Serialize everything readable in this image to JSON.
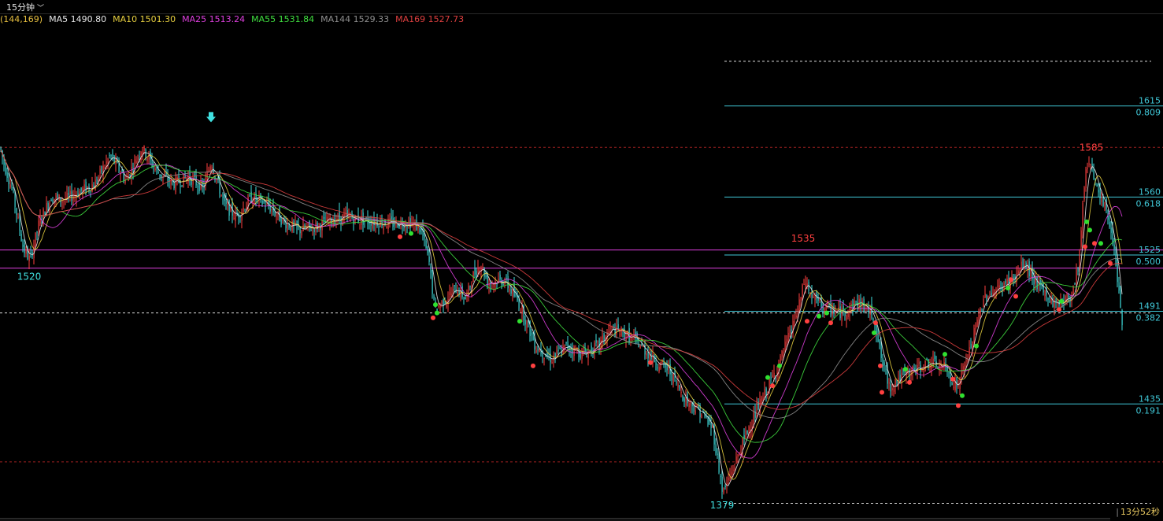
{
  "header": {
    "period_label": "15分钟",
    "chevron": "chevron-down-icon"
  },
  "ma_legend": [
    {
      "label": "(144,169)",
      "color": "#e8c040"
    },
    {
      "label": "MA5 1490.80",
      "color": "#e8e8e8"
    },
    {
      "label": "MA10 1501.30",
      "color": "#e8d040"
    },
    {
      "label": "MA25 1513.24",
      "color": "#e040e0"
    },
    {
      "label": "MA55 1531.84",
      "color": "#40e040"
    },
    {
      "label": "MA144 1529.33",
      "color": "#909090"
    },
    {
      "label": "MA169 1527.73",
      "color": "#e04040"
    }
  ],
  "timer": "13分52秒",
  "colors": {
    "background": "#000000",
    "up": "#ff4040",
    "down": "#40e0e0",
    "fib": "#40c8d8",
    "support": "#e040e0",
    "dashed": "#e0e0e0",
    "red_dashed": "#a02020"
  },
  "chart_data": {
    "type": "candlestick",
    "path": [
      [
        0,
        1590
      ],
      [
        5,
        1580
      ],
      [
        15,
        1565
      ],
      [
        30,
        1528
      ],
      [
        38,
        1522
      ],
      [
        50,
        1545
      ],
      [
        65,
        1560
      ],
      [
        80,
        1558
      ],
      [
        100,
        1563
      ],
      [
        120,
        1568
      ],
      [
        140,
        1585
      ],
      [
        160,
        1570
      ],
      [
        180,
        1590
      ],
      [
        200,
        1575
      ],
      [
        220,
        1568
      ],
      [
        240,
        1572
      ],
      [
        258,
        1565
      ],
      [
        268,
        1582
      ],
      [
        285,
        1555
      ],
      [
        300,
        1548
      ],
      [
        320,
        1560
      ],
      [
        340,
        1555
      ],
      [
        360,
        1545
      ],
      [
        380,
        1540
      ],
      [
        400,
        1542
      ],
      [
        420,
        1546
      ],
      [
        440,
        1548
      ],
      [
        460,
        1546
      ],
      [
        480,
        1545
      ],
      [
        500,
        1544
      ],
      [
        520,
        1545
      ],
      [
        535,
        1540
      ],
      [
        545,
        1520
      ],
      [
        552,
        1492
      ],
      [
        565,
        1498
      ],
      [
        580,
        1505
      ],
      [
        592,
        1498
      ],
      [
        600,
        1512
      ],
      [
        610,
        1520
      ],
      [
        620,
        1508
      ],
      [
        640,
        1510
      ],
      [
        660,
        1495
      ],
      [
        680,
        1470
      ],
      [
        700,
        1462
      ],
      [
        720,
        1470
      ],
      [
        740,
        1465
      ],
      [
        760,
        1470
      ],
      [
        775,
        1480
      ],
      [
        790,
        1478
      ],
      [
        810,
        1472
      ],
      [
        830,
        1462
      ],
      [
        850,
        1455
      ],
      [
        870,
        1438
      ],
      [
        890,
        1430
      ],
      [
        905,
        1420
      ],
      [
        918,
        1381
      ],
      [
        930,
        1395
      ],
      [
        950,
        1420
      ],
      [
        970,
        1440
      ],
      [
        990,
        1460
      ],
      [
        1005,
        1480
      ],
      [
        1015,
        1495
      ],
      [
        1022,
        1510
      ],
      [
        1030,
        1500
      ],
      [
        1050,
        1492
      ],
      [
        1070,
        1490
      ],
      [
        1090,
        1497
      ],
      [
        1110,
        1488
      ],
      [
        1120,
        1460
      ],
      [
        1130,
        1445
      ],
      [
        1140,
        1450
      ],
      [
        1160,
        1455
      ],
      [
        1180,
        1460
      ],
      [
        1200,
        1457
      ],
      [
        1215,
        1445
      ],
      [
        1230,
        1465
      ],
      [
        1250,
        1500
      ],
      [
        1270,
        1505
      ],
      [
        1290,
        1512
      ],
      [
        1300,
        1520
      ],
      [
        1320,
        1505
      ],
      [
        1340,
        1495
      ],
      [
        1360,
        1500
      ],
      [
        1370,
        1520
      ],
      [
        1378,
        1575
      ],
      [
        1385,
        1583
      ],
      [
        1395,
        1560
      ],
      [
        1405,
        1552
      ],
      [
        1415,
        1530
      ],
      [
        1425,
        1485
      ]
    ],
    "ylim": [
      1370,
      1660
    ],
    "x_count": 1425,
    "fib_levels": [
      {
        "price": "1615",
        "ratio": "0.809",
        "value": 1615
      },
      {
        "price": "1560",
        "ratio": "0.618",
        "value": 1560
      },
      {
        "price": "1525",
        "ratio": "0.500",
        "value": 1525
      },
      {
        "price": "1491",
        "ratio": "0.382",
        "value": 1491
      },
      {
        "price": "1435",
        "ratio": "0.191",
        "value": 1435
      }
    ],
    "fib_start_x": 920,
    "support_lines": [
      1528,
      1517
    ],
    "dashed_lines": [
      1642,
      1490,
      1375
    ],
    "red_dashed_lines": [
      1590,
      1400
    ],
    "annotations": [
      {
        "text": "1520",
        "x": 37,
        "y": 1510,
        "color": "#40e0e0"
      },
      {
        "text": "1535",
        "x": 1020,
        "y": 1533,
        "color": "#ff4040"
      },
      {
        "text": "1585",
        "x": 1386,
        "y": 1588,
        "color": "#ff4040"
      },
      {
        "text": "1379",
        "x": 917,
        "y": 1372,
        "color": "#40e0e0"
      }
    ],
    "arrow": {
      "x": 268,
      "y": 1608
    },
    "red_dots": [
      [
        508,
        1536
      ],
      [
        550,
        1487
      ],
      [
        677,
        1458
      ],
      [
        826,
        1460
      ],
      [
        981,
        1446
      ],
      [
        1025,
        1485
      ],
      [
        1055,
        1484
      ],
      [
        1112,
        1484
      ],
      [
        1118,
        1458
      ],
      [
        1120,
        1442
      ],
      [
        1155,
        1448
      ],
      [
        1210,
        1450
      ],
      [
        1217,
        1434
      ],
      [
        1284,
        1510
      ],
      [
        1290,
        1500
      ],
      [
        1345,
        1492
      ],
      [
        1378,
        1530
      ],
      [
        1390,
        1532
      ],
      [
        1410,
        1520
      ]
    ],
    "green_dots": [
      [
        522,
        1538
      ],
      [
        553,
        1495
      ],
      [
        555,
        1490
      ],
      [
        660,
        1485
      ],
      [
        975,
        1451
      ],
      [
        990,
        1458
      ],
      [
        1040,
        1488
      ],
      [
        1050,
        1490
      ],
      [
        1110,
        1478
      ],
      [
        1150,
        1456
      ],
      [
        1200,
        1465
      ],
      [
        1222,
        1440
      ],
      [
        1240,
        1470
      ],
      [
        1280,
        1505
      ],
      [
        1348,
        1497
      ],
      [
        1380,
        1545
      ],
      [
        1384,
        1540
      ],
      [
        1398,
        1532
      ]
    ]
  }
}
